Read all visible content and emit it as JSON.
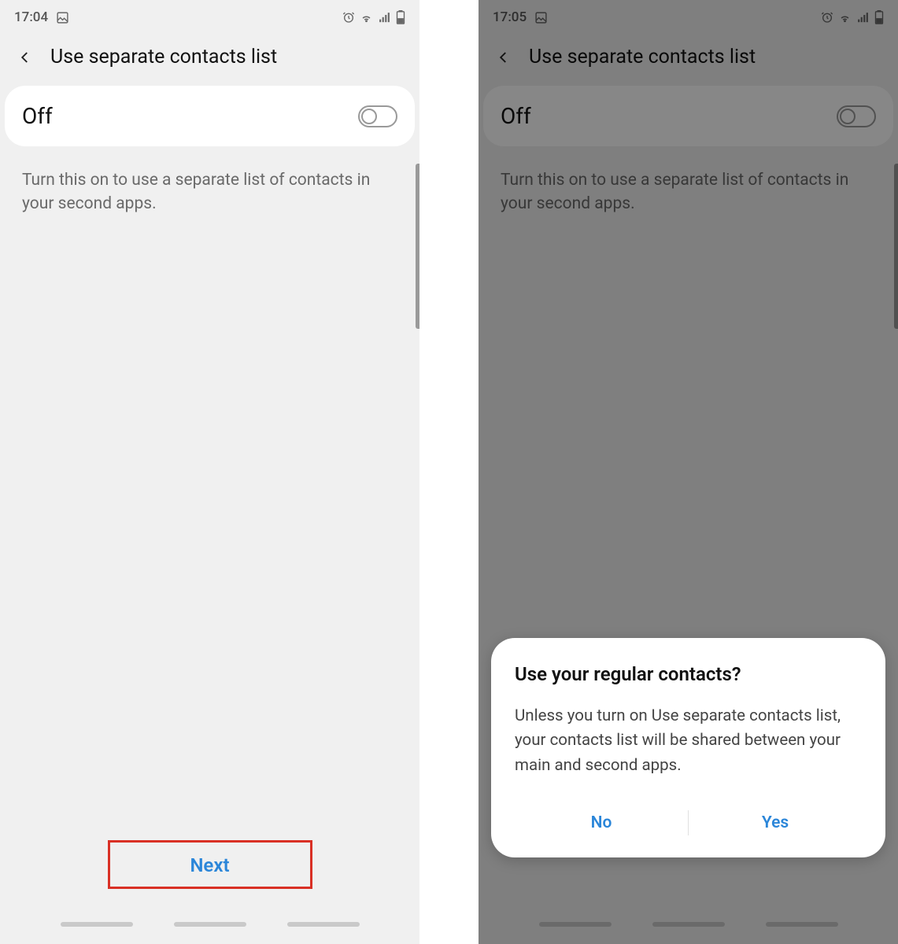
{
  "left": {
    "status": {
      "time": "17:04"
    },
    "title": "Use separate contacts list",
    "toggle_label": "Off",
    "description": "Turn this on to use a separate list of contacts in your second apps.",
    "next_label": "Next"
  },
  "right": {
    "status": {
      "time": "17:05"
    },
    "title": "Use separate contacts list",
    "toggle_label": "Off",
    "description": "Turn this on to use a separate list of contacts in your second apps.",
    "dialog": {
      "title": "Use your regular contacts?",
      "body": "Unless you turn on Use separate contacts list, your contacts list will be shared between your main and second apps.",
      "no_label": "No",
      "yes_label": "Yes"
    }
  }
}
